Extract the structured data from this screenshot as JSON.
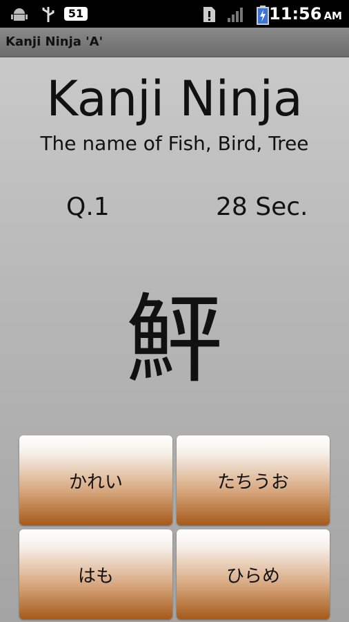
{
  "status_bar": {
    "notification_count": "51",
    "time": "11:56",
    "ampm": "AM",
    "icons": [
      "android-debug-icon",
      "usb-icon",
      "sim-alert-icon",
      "signal-icon",
      "battery-charging-icon"
    ]
  },
  "app": {
    "window_title": "Kanji Ninja 'A'",
    "title": "Kanji Ninja",
    "subtitle": "The name of Fish, Bird, Tree"
  },
  "quiz": {
    "question_label": "Q.1",
    "timer": "28 Sec.",
    "kanji": "鮃",
    "answers": [
      "かれい",
      "たちうお",
      "はも",
      "ひらめ"
    ]
  },
  "colors": {
    "button_top": "#ffffff",
    "button_bottom": "#a65a1a",
    "background": "#b6b6b6"
  }
}
